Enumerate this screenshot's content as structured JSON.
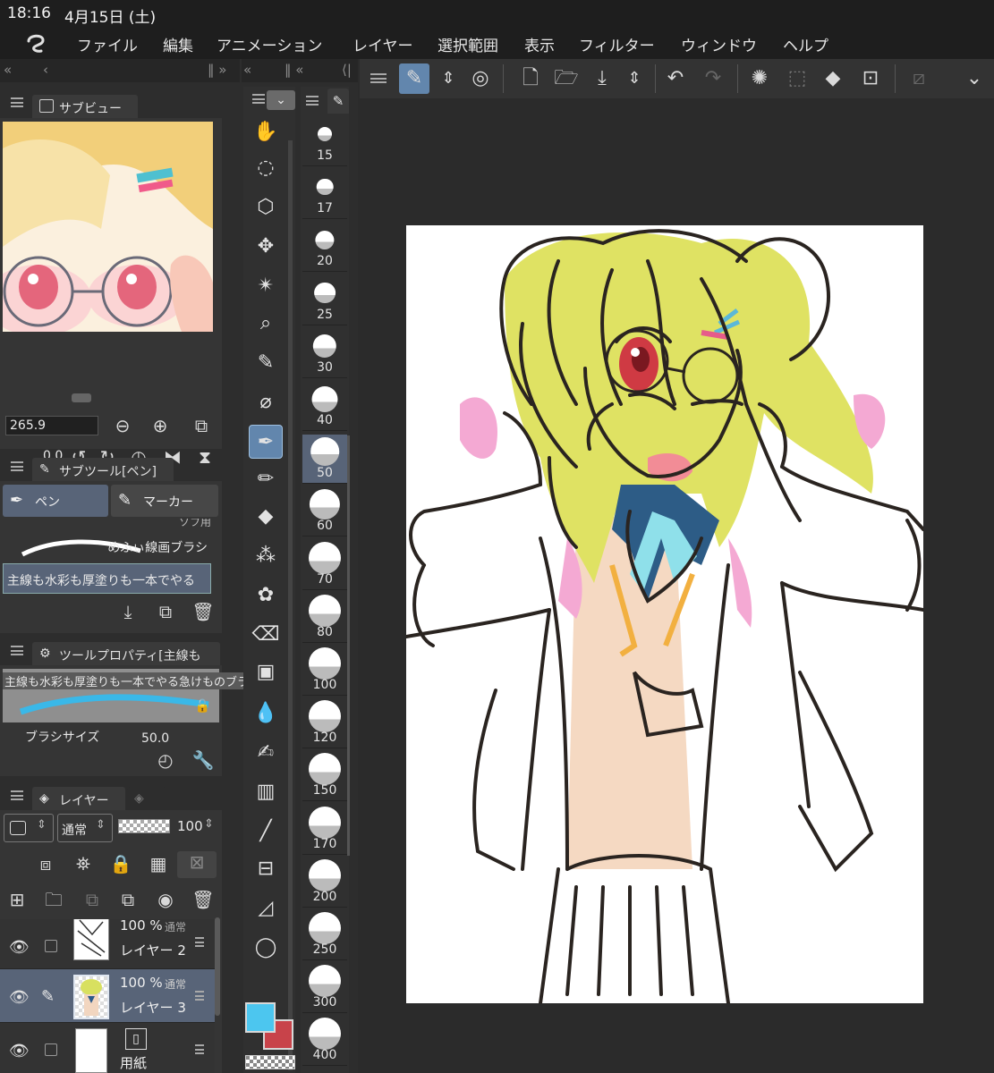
{
  "status_bar": {
    "time": "18:16",
    "date": "4月15日 (土)"
  },
  "menu": [
    "ファイル",
    "編集",
    "アニメーション",
    "レイヤー",
    "選択範囲",
    "表示",
    "フィルター",
    "ウィンドウ",
    "ヘルプ"
  ],
  "subview": {
    "tab_label": "サブビュー",
    "zoom": "265.9",
    "rotation": "0.0"
  },
  "subtool": {
    "tab_label": "サブツール[ペン]",
    "tabs": [
      "ペン",
      "マーカー"
    ],
    "brushes": [
      "ソフ用",
      "めふぃ線画ブラシ",
      "主線も水彩も厚塗りも一本でやる"
    ]
  },
  "tool_property": {
    "tab_label": "ツールプロパティ[主線も",
    "brush_name": "主線も水彩も厚塗りも一本でやる急けものブラ",
    "brush_size_label": "ブラシサイズ",
    "brush_size_value": "50.0"
  },
  "layers": {
    "tab_label": "レイヤー",
    "blend_mode": "通常",
    "opacity": "100",
    "items": [
      {
        "opacity": "100 %",
        "mode": "通常",
        "name": "レイヤー 2",
        "selected": false
      },
      {
        "opacity": "100 %",
        "mode": "通常",
        "name": "レイヤー 3",
        "selected": true
      },
      {
        "opacity": "",
        "mode": "",
        "name": "用紙",
        "selected": false
      }
    ]
  },
  "brush_sizes": [
    "15",
    "17",
    "20",
    "25",
    "30",
    "40",
    "50",
    "60",
    "70",
    "80",
    "100",
    "120",
    "150",
    "170",
    "200",
    "250",
    "300",
    "400"
  ],
  "active_brush_size": "50",
  "colors": {
    "main": "#4cc6ef",
    "sub": "#c8434a",
    "accent": "#6286ad",
    "panel": "#353535"
  },
  "tool_icons": [
    "hand-icon",
    "lasso-icon",
    "3d-object-icon",
    "move-icon",
    "magic-wand-icon",
    "zoom-icon",
    "eyedropper-icon",
    "marker-icon",
    "pen-icon",
    "pencil-icon",
    "fill-icon",
    "airbrush-icon",
    "decoration-icon",
    "eraser-icon",
    "material-icon",
    "blend-icon",
    "ruler-icon",
    "gradient-icon",
    "line-icon",
    "frame-icon",
    "figure-icon",
    "text-balloon-icon"
  ]
}
